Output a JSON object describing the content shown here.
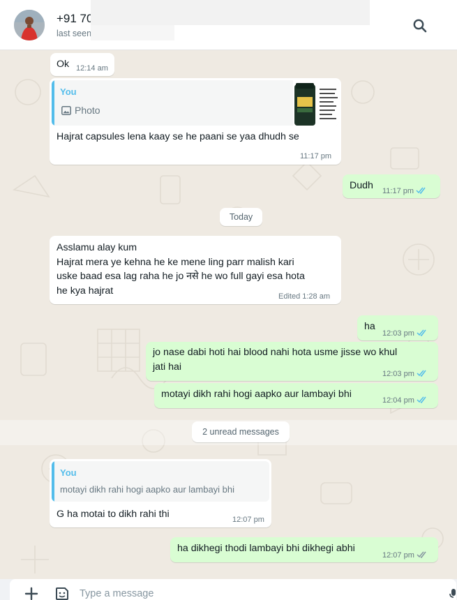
{
  "header": {
    "contact_name": "+91 70",
    "last_seen": "last seen",
    "search_icon": "search-icon"
  },
  "messages": {
    "m1": {
      "text": "Ok",
      "time": "12:14 am"
    },
    "m2": {
      "quote_author": "You",
      "quote_label": "Photo",
      "text": "Hajrat capsules lena kaay se he paani se yaa dhudh se",
      "time": "11:17 pm"
    },
    "m3": {
      "text": "Dudh",
      "time": "11:17 pm"
    },
    "date_pill": "Today",
    "m4": {
      "text": "Asslamu alay kum\nHajrat mera ye kehna he ke mene ling parr malish kari\nuske baad esa lag raha he jo  नसे he wo full gayi esa hota\nhe kya hajrat",
      "time": "Edited 1:28 am"
    },
    "m5": {
      "text": "ha",
      "time": "12:03 pm"
    },
    "m6": {
      "text": "jo nase dabi hoti hai blood nahi hota usme jisse wo khul\njati hai",
      "time": "12:03 pm"
    },
    "m7": {
      "text": "motayi  dikh rahi hogi aapko aur lambayi bhi",
      "time": "12:04 pm"
    },
    "unread_pill": "2 unread messages",
    "m8": {
      "quote_author": "You",
      "quote_text": "motayi  dikh rahi hogi aapko aur lambayi bhi",
      "text": "G ha motai to dikh rahi thi",
      "time": "12:07 pm"
    },
    "m9": {
      "text": "ha dikhegi thodi lambayi bhi dikhegi abhi",
      "time": "12:07 pm"
    }
  },
  "composer": {
    "placeholder": "Type a message"
  },
  "colors": {
    "chat_bg": "#efeae2",
    "incoming": "#ffffff",
    "outgoing": "#d9fdd3",
    "read_ticks": "#53bdeb",
    "sent_ticks": "#8696a0"
  }
}
